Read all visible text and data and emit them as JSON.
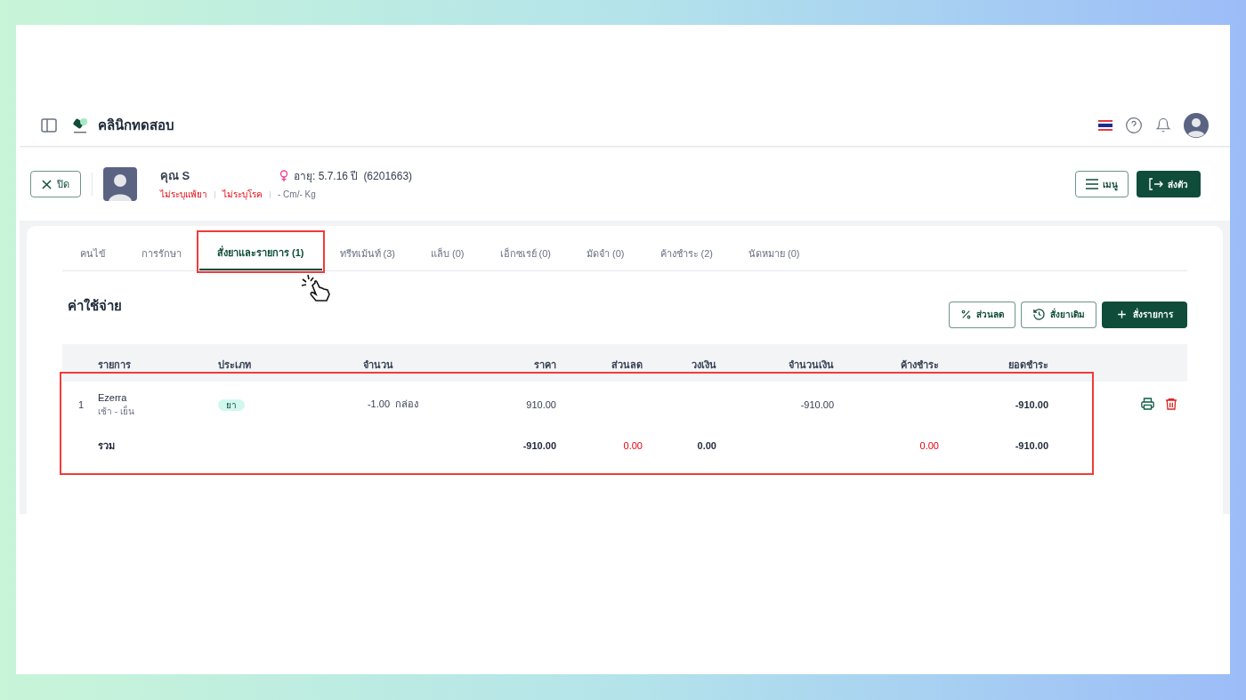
{
  "header": {
    "clinic_name": "คลินิกทดสอบ"
  },
  "patient": {
    "name": "คุณ S",
    "age": "อายุ: 5.7.16 ปี",
    "id": "(6201663)",
    "allergy": "ไม่ระบุแพ้ยา",
    "disease": "ไม่ระบุโรค",
    "body": "- Cm/- Kg"
  },
  "buttons": {
    "close": "ปิด",
    "menu": "เมนู",
    "send": "ส่งตัว"
  },
  "tabs": [
    {
      "label": "คนไข้",
      "selected": false
    },
    {
      "label": "การรักษา",
      "selected": false
    },
    {
      "label": "สั่งยาและรายการ (1)",
      "selected": true
    },
    {
      "label": "ทรีทเม้นท์ (3)",
      "selected": false
    },
    {
      "label": "แล็บ (0)",
      "selected": false
    },
    {
      "label": "เอ็กซเรย์ (0)",
      "selected": false
    },
    {
      "label": "มัดจำ (0)",
      "selected": false
    },
    {
      "label": "ค้างชำระ (2)",
      "selected": false
    },
    {
      "label": "นัดหมาย (0)",
      "selected": false
    }
  ],
  "section_title": "ค่าใช้จ่าย",
  "actions": [
    "ส่วนลด",
    "สั่งยาเดิม",
    "สั่งรายการ"
  ],
  "table": {
    "columns": [
      "รายการ",
      "ประเภท",
      "จำนวน",
      "ราคา",
      "ส่วนลด",
      "วงเงิน",
      "จำนวนเงิน",
      "ค้างชำระ",
      "ยอดชำระ"
    ],
    "rows": [
      {
        "no": "1",
        "item": "Ezerra",
        "note": "เช้า - เย็น",
        "type": "ยา",
        "qty": "-1.00",
        "unit": "กล่อง",
        "price": "910.00",
        "amount": "-910.00",
        "payable": "-910.00"
      }
    ],
    "total": {
      "label": "รวม",
      "price": "-910.00",
      "discount": "0.00",
      "limit": "0.00",
      "outstanding": "0.00",
      "payable": "-910.00"
    }
  }
}
